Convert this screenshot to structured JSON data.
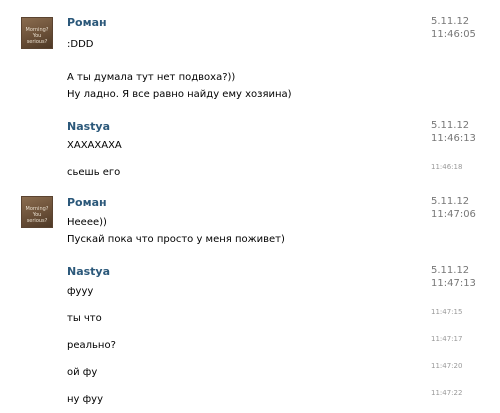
{
  "messages": [
    {
      "author": "Роман",
      "avatar_caption": "Morning? You serious?",
      "date": "5.11.12",
      "time": "11:46:05",
      "lines": [
        ":DDD",
        "",
        "А ты думала тут нет подвоха?))",
        "Ну ладно. Я все равно найду ему хозяина)"
      ]
    },
    {
      "author": "Nastya",
      "date": "5.11.12",
      "time": "11:46:13",
      "lines": [
        "ХАХАХАХА"
      ],
      "followups": [
        {
          "time": "11:46:18",
          "text": "сьешь его"
        }
      ]
    },
    {
      "author": "Роман",
      "avatar_caption": "Morning? You serious?",
      "date": "5.11.12",
      "time": "11:47:06",
      "lines": [
        "Неeee))",
        "Пускай пока что просто у меня поживет)"
      ]
    },
    {
      "author": "Nastya",
      "date": "5.11.12",
      "time": "11:47:13",
      "lines": [
        "фууу"
      ],
      "followups": [
        {
          "time": "11:47:15",
          "text": "ты что"
        },
        {
          "time": "11:47:17",
          "text": "реально?"
        },
        {
          "time": "11:47:20",
          "text": "ой фу"
        },
        {
          "time": "11:47:22",
          "text": "ну фуу"
        }
      ]
    }
  ]
}
